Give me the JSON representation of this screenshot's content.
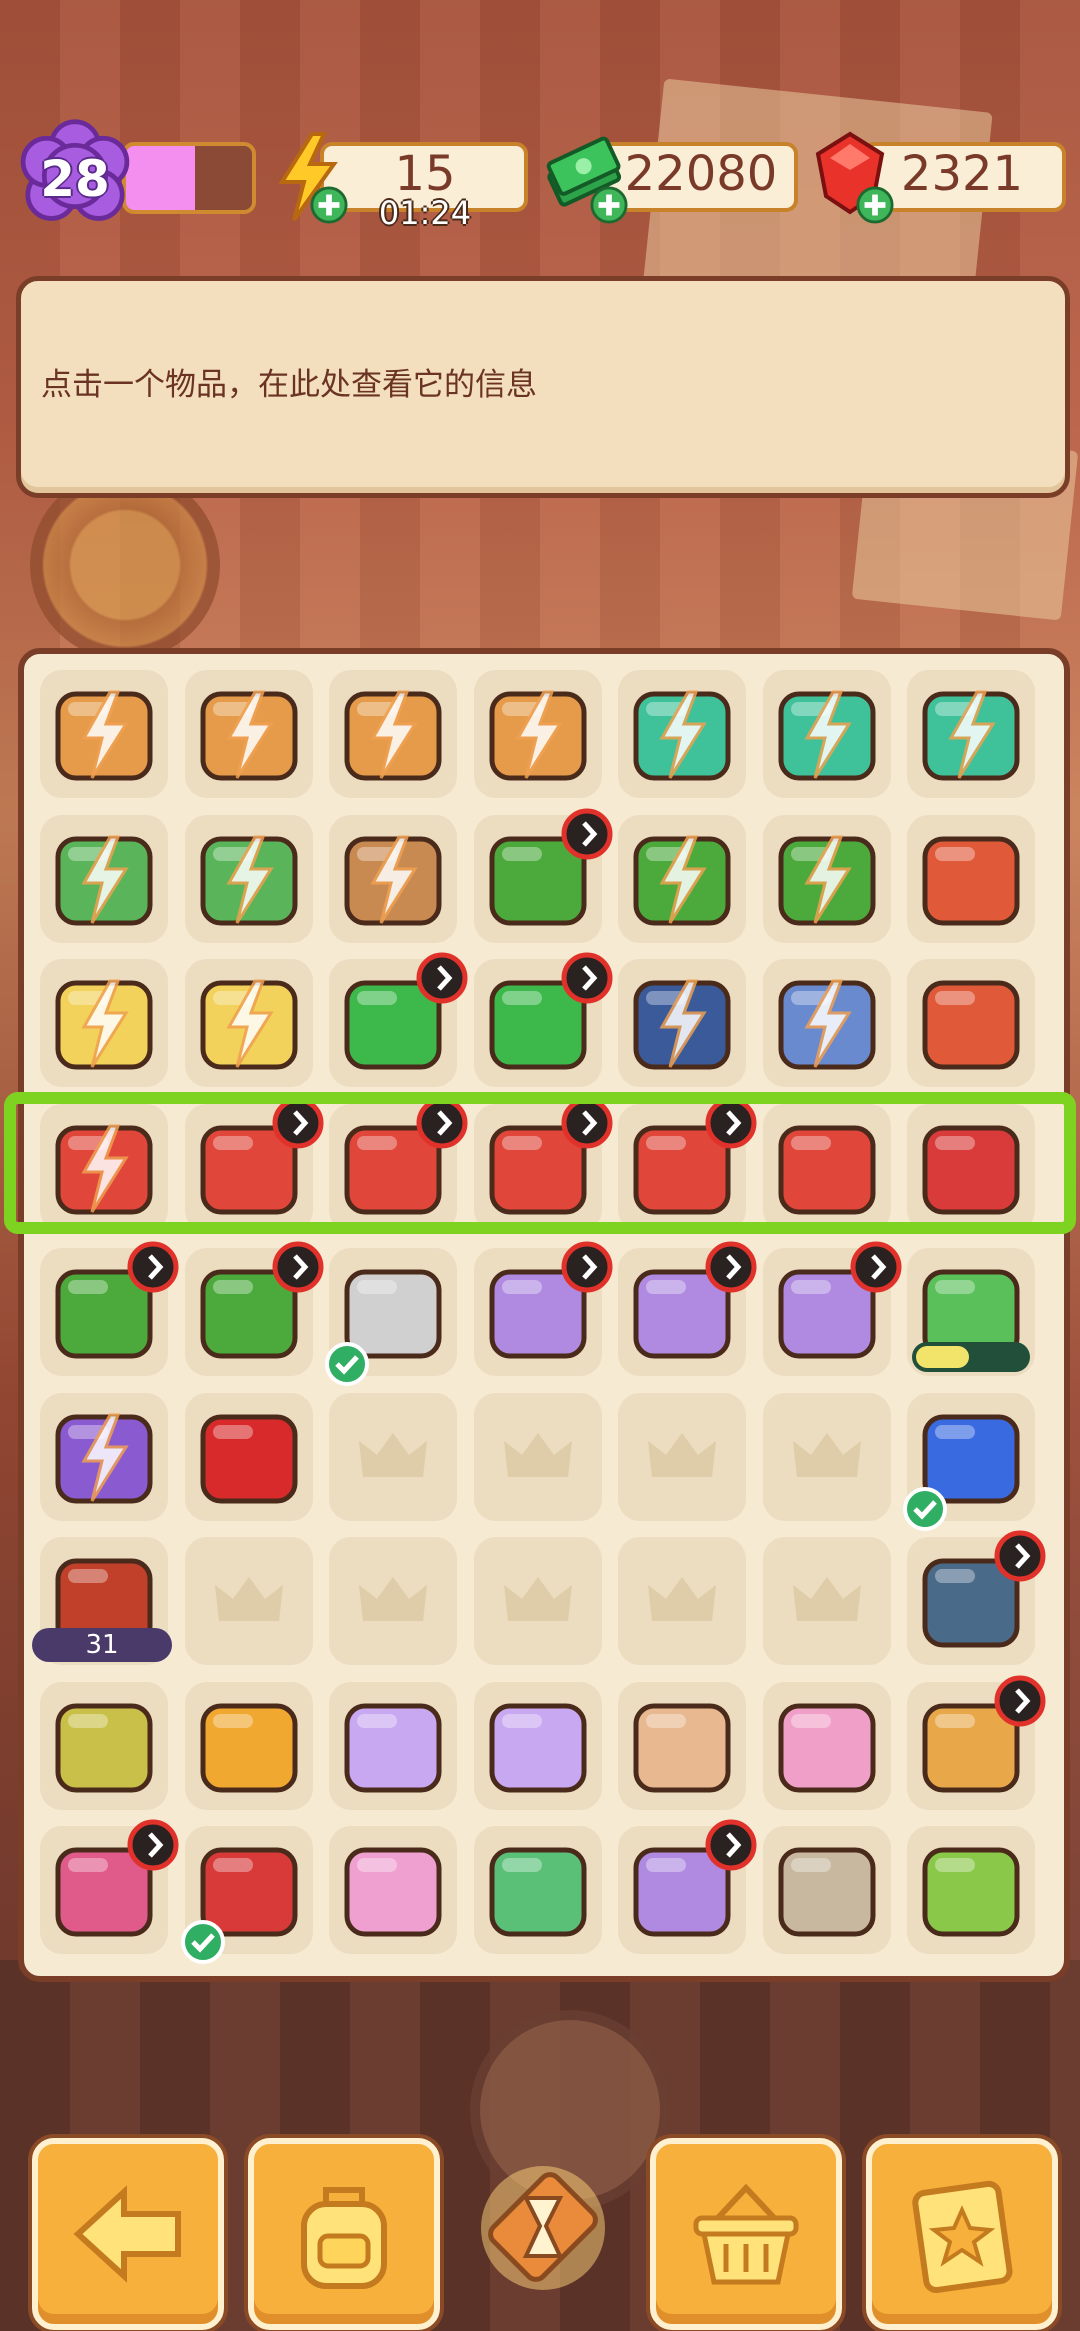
{
  "hud": {
    "level": "28",
    "level_progress": 0.55,
    "energy": "15",
    "energy_timer": "01:24",
    "cash": "22080",
    "gems": "2321"
  },
  "info_panel": {
    "text": "点击一个物品，在此处查看它的信息"
  },
  "board": {
    "rows": 9,
    "cols": 7,
    "highlighted_row": 4,
    "special_labels": {
      "tv_energy_cost": "31",
      "sunglasses_progress": 0.45
    }
  },
  "icons": {
    "level": "purple-flower-badge-icon",
    "energy": "lightning-bolt-icon",
    "cash": "green-cash-stack-icon",
    "gems": "red-gem-icon",
    "back": "back-arrow-icon",
    "bag": "backpack-icon",
    "hourglass": "hourglass-icon",
    "basket": "basket-icon",
    "tasks": "star-clipboard-icon"
  },
  "colors": {
    "highlight": "#7ed321",
    "panel_border": "#7a3e28",
    "button": "#f7b03b"
  }
}
